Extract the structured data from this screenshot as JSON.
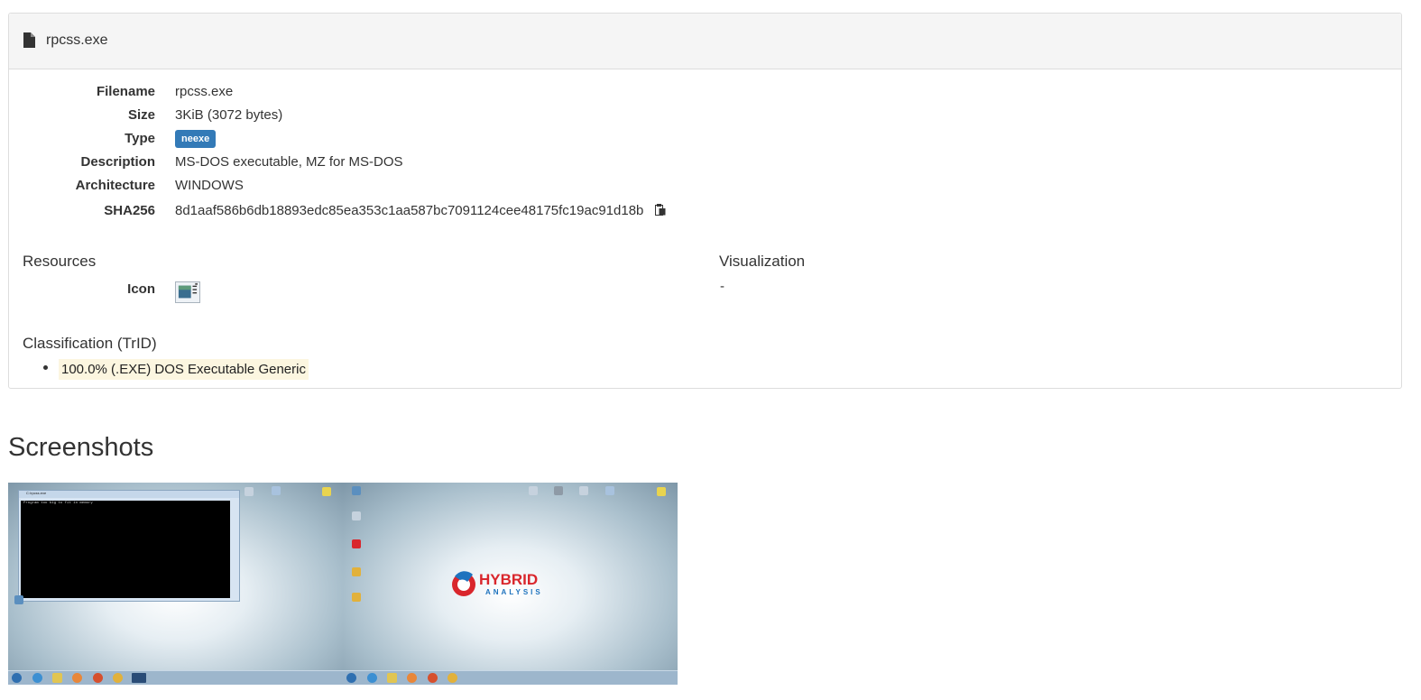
{
  "panel": {
    "title": "rpcss.exe",
    "fields": {
      "filename": {
        "label": "Filename",
        "value": "rpcss.exe"
      },
      "size": {
        "label": "Size",
        "value": "3KiB (3072 bytes)"
      },
      "type": {
        "label": "Type",
        "value": "neexe"
      },
      "description": {
        "label": "Description",
        "value": "MS-DOS executable, MZ for MS-DOS"
      },
      "architecture": {
        "label": "Architecture",
        "value": "WINDOWS"
      },
      "sha256": {
        "label": "SHA256",
        "value": "8d1aaf586b6db18893edc85ea353c1aa587bc7091124cee48175fc19ac91d18b"
      }
    },
    "resources": {
      "heading": "Resources",
      "icon_label": "Icon"
    },
    "visualization": {
      "heading": "Visualization",
      "value": "-"
    },
    "classification": {
      "heading": "Classification (TrID)",
      "items": [
        "100.0% (.EXE) DOS Executable Generic"
      ]
    }
  },
  "screenshots": {
    "heading": "Screenshots",
    "shot1": {
      "window_title": "C:\\rpcss.exe",
      "console_text": "Program too big to fit in memory"
    },
    "shot2": {
      "logo_top": "HYBRID",
      "logo_bottom": "ANALYSIS"
    }
  },
  "colors": {
    "badge": "#337ab7",
    "highlight": "#fcf6e0",
    "panel_head": "#f5f5f5",
    "logo_red": "#d9262c",
    "logo_blue": "#1e73be"
  }
}
